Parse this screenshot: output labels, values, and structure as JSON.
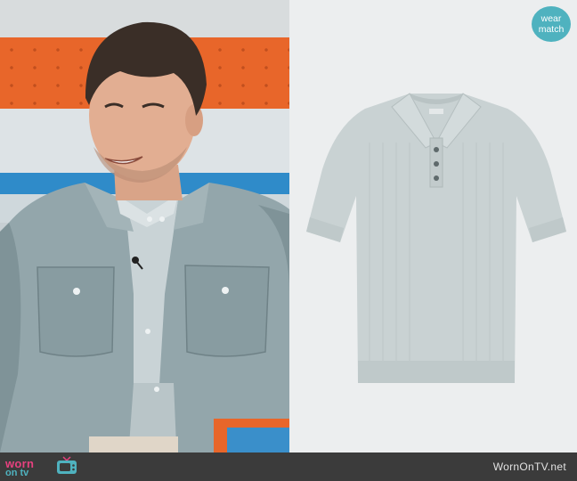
{
  "badge": {
    "line1": "wear",
    "line2": "match"
  },
  "logo": {
    "word1": "worn",
    "word2": "on tv"
  },
  "footer": {
    "site": "WornOnTV.net"
  },
  "colors": {
    "badge": "#4fb2bf",
    "logo_pink": "#e7417f",
    "logo_teal": "#4fb2bf",
    "footer_bg": "#3b3b3b",
    "shirt": "#c9d2d3",
    "jacket": "#93a6ab"
  },
  "icons": [
    "tv-icon"
  ]
}
